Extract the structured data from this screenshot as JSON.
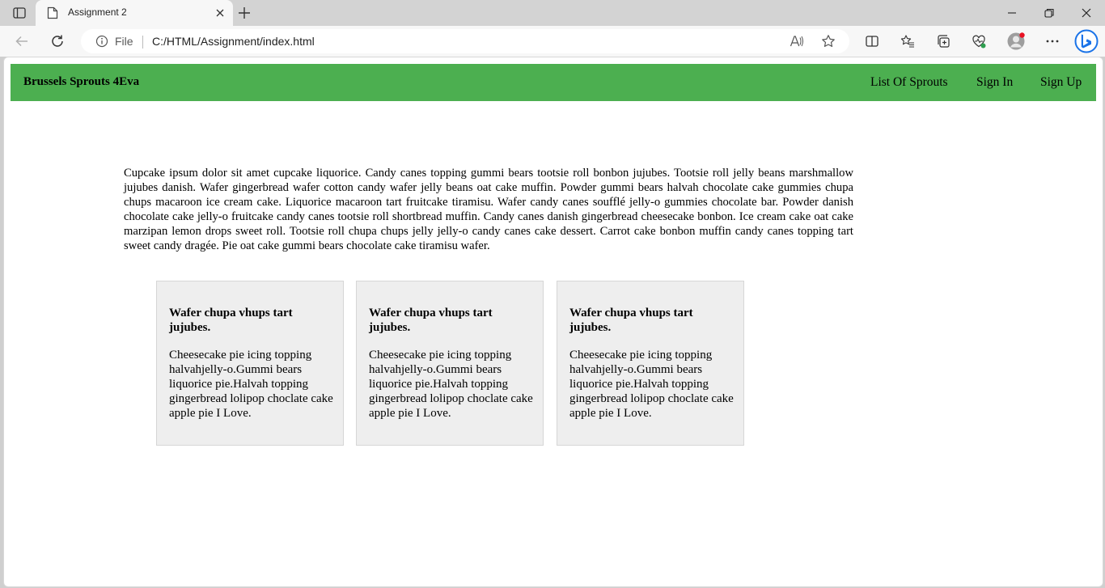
{
  "browser": {
    "tab_title": "Assignment 2",
    "address_scheme_label": "File",
    "address_url": "C:/HTML/Assignment/index.html"
  },
  "icons": {
    "tab_actions": "tab-actions-icon",
    "favicon": "page-icon",
    "close": "close-icon",
    "new_tab": "plus-icon",
    "minimize": "minimize-icon",
    "restore": "restore-icon",
    "window_close": "close-icon",
    "back": "back-arrow-icon",
    "refresh": "refresh-icon",
    "info": "info-icon",
    "read_aloud": "read-aloud-icon",
    "favorite": "star-icon",
    "split_screen": "split-screen-icon",
    "favorites": "favorites-icon",
    "collections": "collections-icon",
    "performance": "heartbeat-icon",
    "profile": "profile-avatar-icon",
    "more": "more-icon",
    "copilot": "bing-copilot-icon"
  },
  "colors": {
    "navbar": "#4caf50",
    "card_bg": "#eeeeee",
    "notification_dot": "#e81123",
    "copilot": "#1a73e8"
  },
  "page": {
    "brand": "Brussels Sprouts 4Eva",
    "nav_links": [
      "List Of Sprouts",
      "Sign In",
      "Sign Up"
    ],
    "intro": "Cupcake ipsum dolor sit amet cupcake liquorice. Candy canes topping gummi bears tootsie roll bonbon jujubes. Tootsie roll jelly beans marshmallow jujubes danish. Wafer gingerbread wafer cotton candy wafer jelly beans oat cake muffin. Powder gummi bears halvah chocolate cake gummies chupa chups macaroon ice cream cake. Liquorice macaroon tart fruitcake tiramisu. Wafer candy canes soufflé jelly-o gummies chocolate bar. Powder danish chocolate cake jelly-o fruitcake candy canes tootsie roll shortbread muffin. Candy canes danish gingerbread cheesecake bonbon. Ice cream cake oat cake marzipan lemon drops sweet roll. Tootsie roll chupa chups jelly jelly-o candy canes cake dessert. Carrot cake bonbon muffin candy canes topping tart sweet candy dragée. Pie oat cake gummi bears chocolate cake tiramisu wafer.",
    "cards": [
      {
        "title": "Wafer chupa vhups tart jujubes.",
        "text": "Cheesecake pie icing topping halvahjelly-o.Gummi bears liquorice pie.Halvah topping gingerbread lolipop choclate cake apple pie I Love."
      },
      {
        "title": "Wafer chupa vhups tart jujubes.",
        "text": "Cheesecake pie icing topping halvahjelly-o.Gummi bears liquorice pie.Halvah topping gingerbread lolipop choclate cake apple pie I Love."
      },
      {
        "title": "Wafer chupa vhups tart jujubes.",
        "text": "Cheesecake pie icing topping halvahjelly-o.Gummi bears liquorice pie.Halvah topping gingerbread lolipop choclate cake apple pie I Love."
      }
    ]
  }
}
